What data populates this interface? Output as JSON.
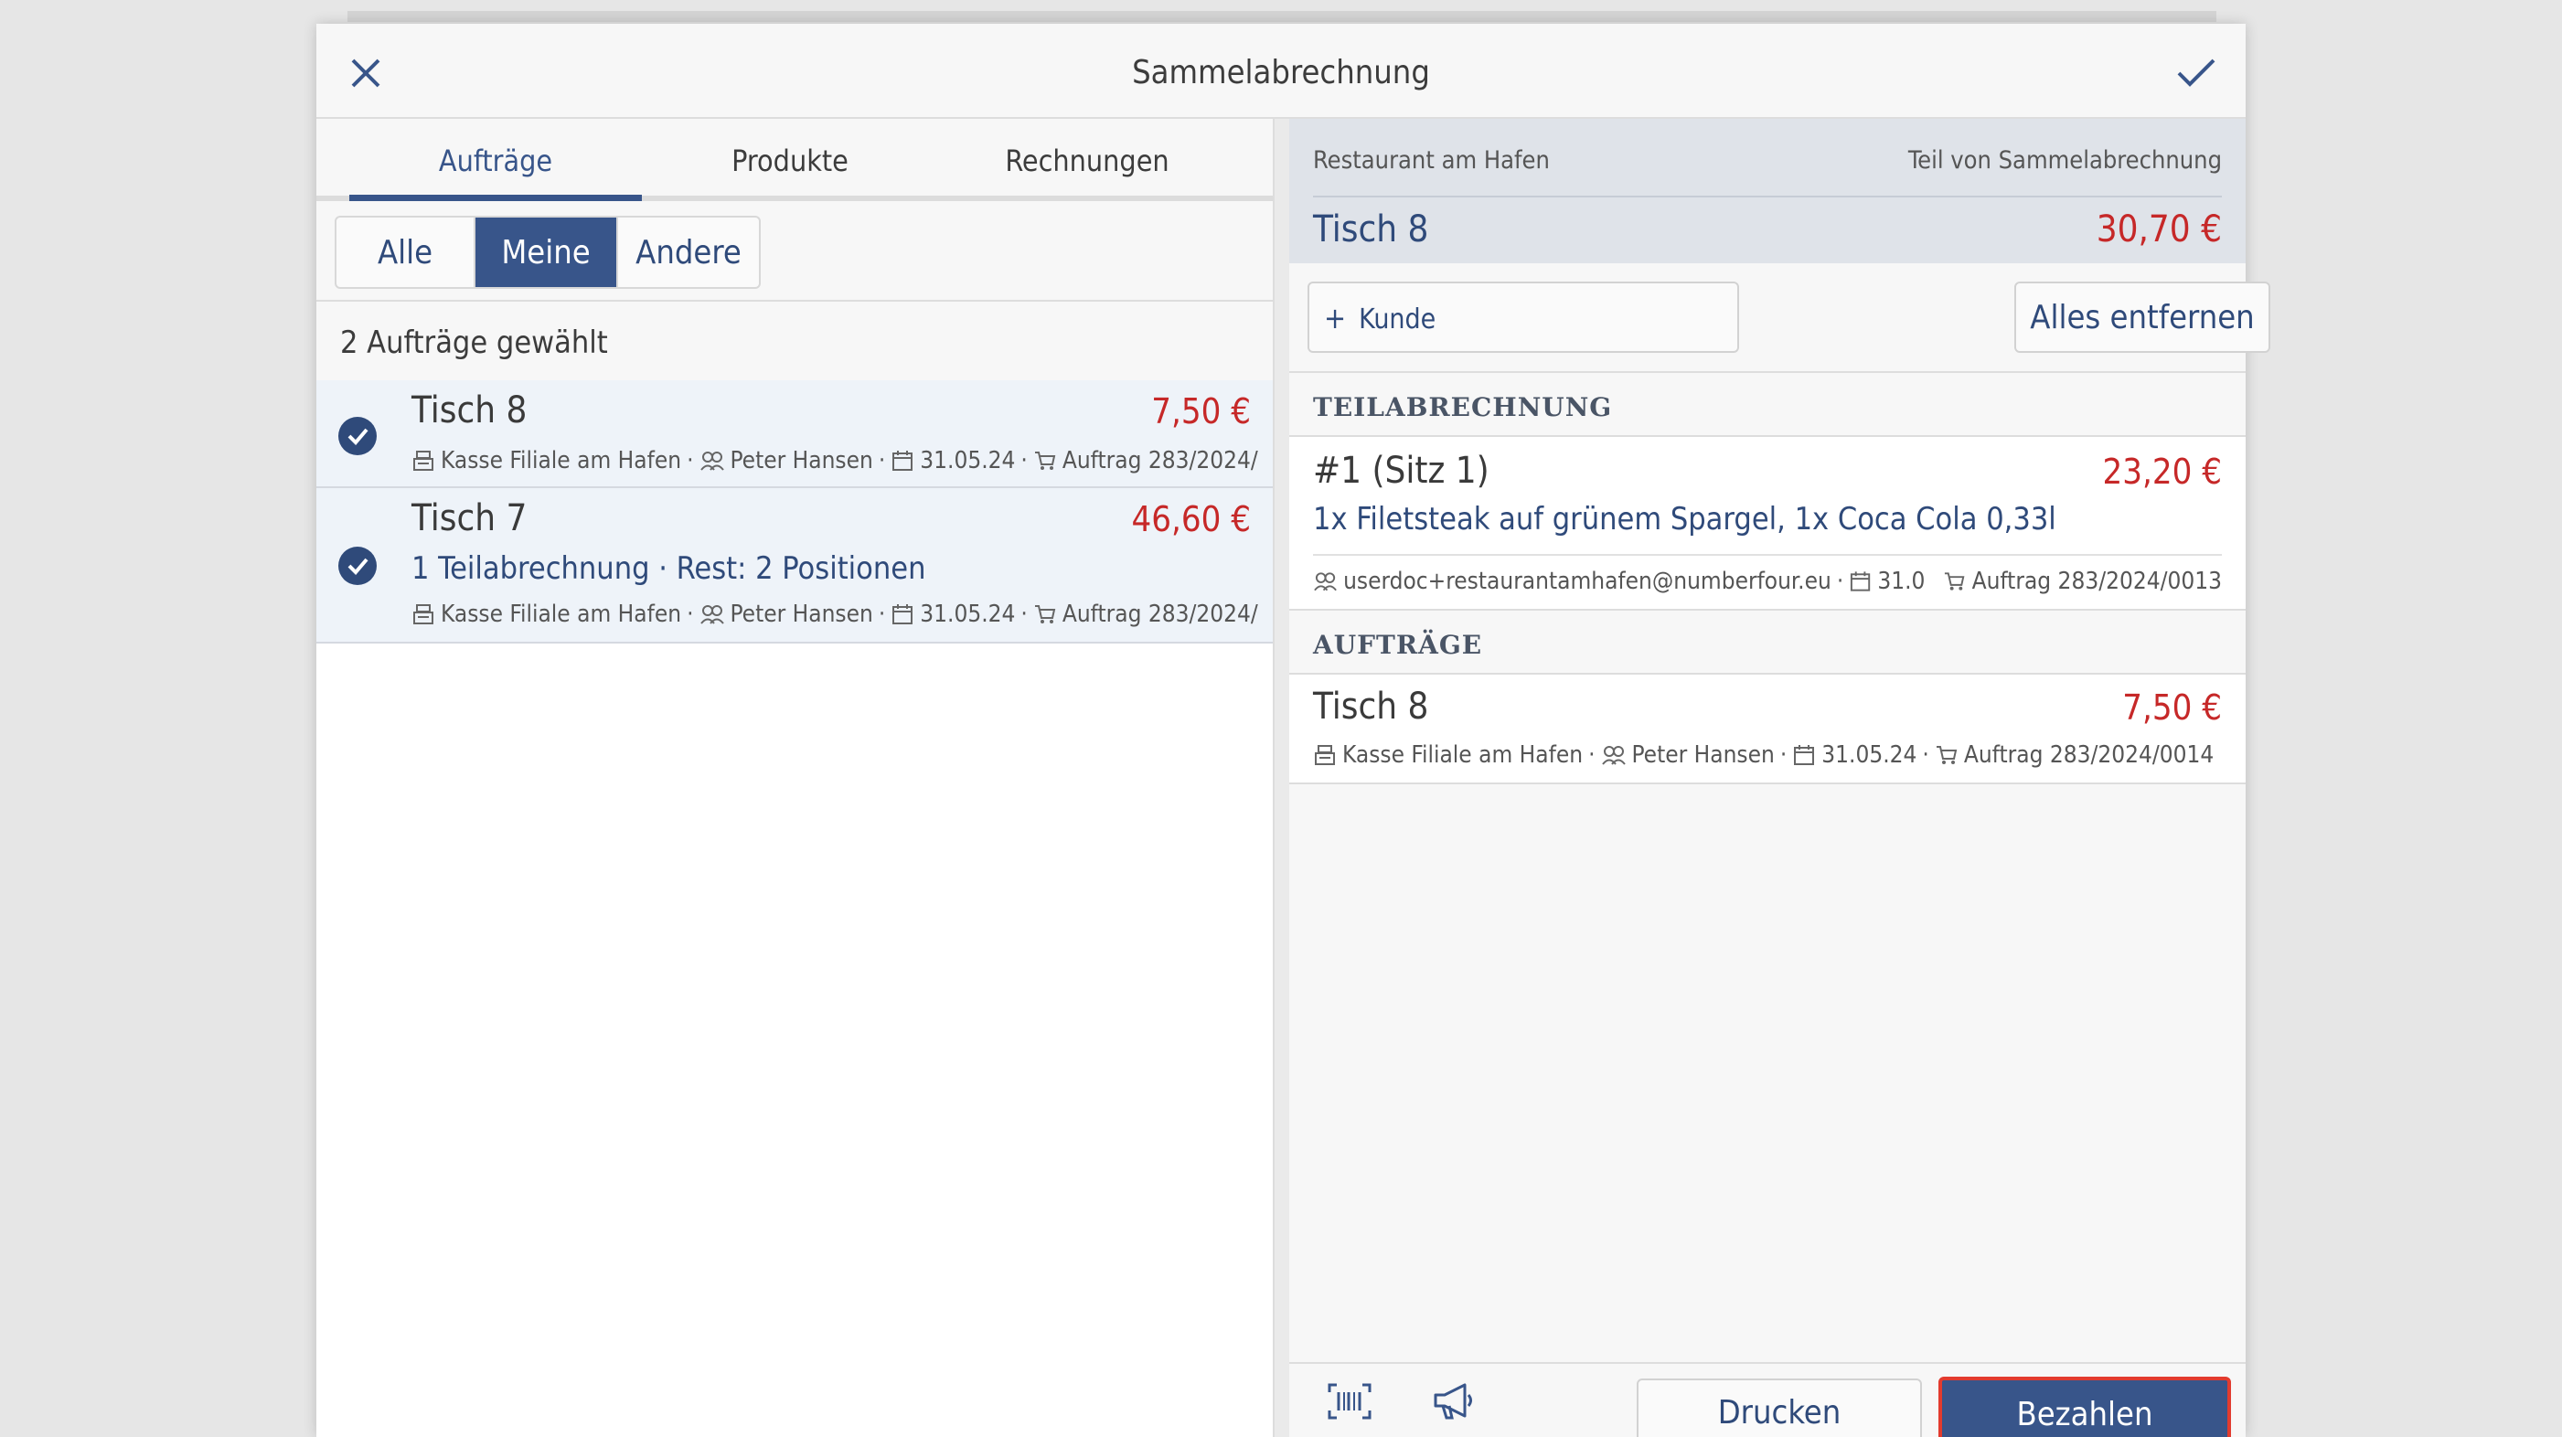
{
  "dialog": {
    "title": "Sammelabrechnung",
    "close_icon": "close-icon",
    "confirm_icon": "checkmark-icon"
  },
  "tabs": [
    {
      "label": "Aufträge",
      "active": true
    },
    {
      "label": "Produkte",
      "active": false
    },
    {
      "label": "Rechnungen",
      "active": false
    }
  ],
  "filter": {
    "options": [
      "Alle",
      "Meine",
      "Andere"
    ],
    "selected": "Meine"
  },
  "selection_count": "2 Aufträge gewählt",
  "orders": [
    {
      "title": "Tisch 8",
      "price": "7,50 €",
      "subtitle": "",
      "register": "Kasse Filiale am Hafen",
      "user": "Peter Hansen",
      "date": "31.05.24",
      "order_no": "Auftrag 283/2024/",
      "selected": true
    },
    {
      "title": "Tisch 7",
      "price": "46,60 €",
      "subtitle": "1 Teilabrechnung · Rest: 2 Positionen",
      "register": "Kasse Filiale am Hafen",
      "user": "Peter Hansen",
      "date": "31.05.24",
      "order_no": "Auftrag 283/2024/",
      "selected": true
    }
  ],
  "summary": {
    "restaurant": "Restaurant am Hafen",
    "part_of": "Teil von Sammelabrechnung",
    "table": "Tisch 8",
    "total": "30,70 €"
  },
  "actions": {
    "customer_label": "Kunde",
    "remove_all_label": "Alles entfernen"
  },
  "partial_section": {
    "heading": "TEILABRECHNUNG",
    "items": [
      {
        "title": "#1 (Sitz 1)",
        "price": "23,20 €",
        "description": "1x Filetsteak auf grünem Spargel, 1x Coca Cola 0,33l",
        "user": "userdoc+restaurantamhafen@numberfour.eu",
        "date": "31.0",
        "order_no": "Auftrag 283/2024/0013"
      }
    ]
  },
  "orders_section": {
    "heading": "AUFTRÄGE",
    "items": [
      {
        "title": "Tisch 8",
        "price": "7,50 €",
        "register": "Kasse Filiale am Hafen",
        "user": "Peter Hansen",
        "date": "31.05.24",
        "order_no": "Auftrag 283/2024/0014"
      }
    ]
  },
  "footer": {
    "barcode_icon": "barcode-scanner-icon",
    "announce_icon": "megaphone-icon",
    "print_label": "Drucken",
    "pay_label": "Bezahlen"
  },
  "colors": {
    "accent": "#38558a",
    "price": "#c62828",
    "pay_highlight": "#e23b2e"
  }
}
